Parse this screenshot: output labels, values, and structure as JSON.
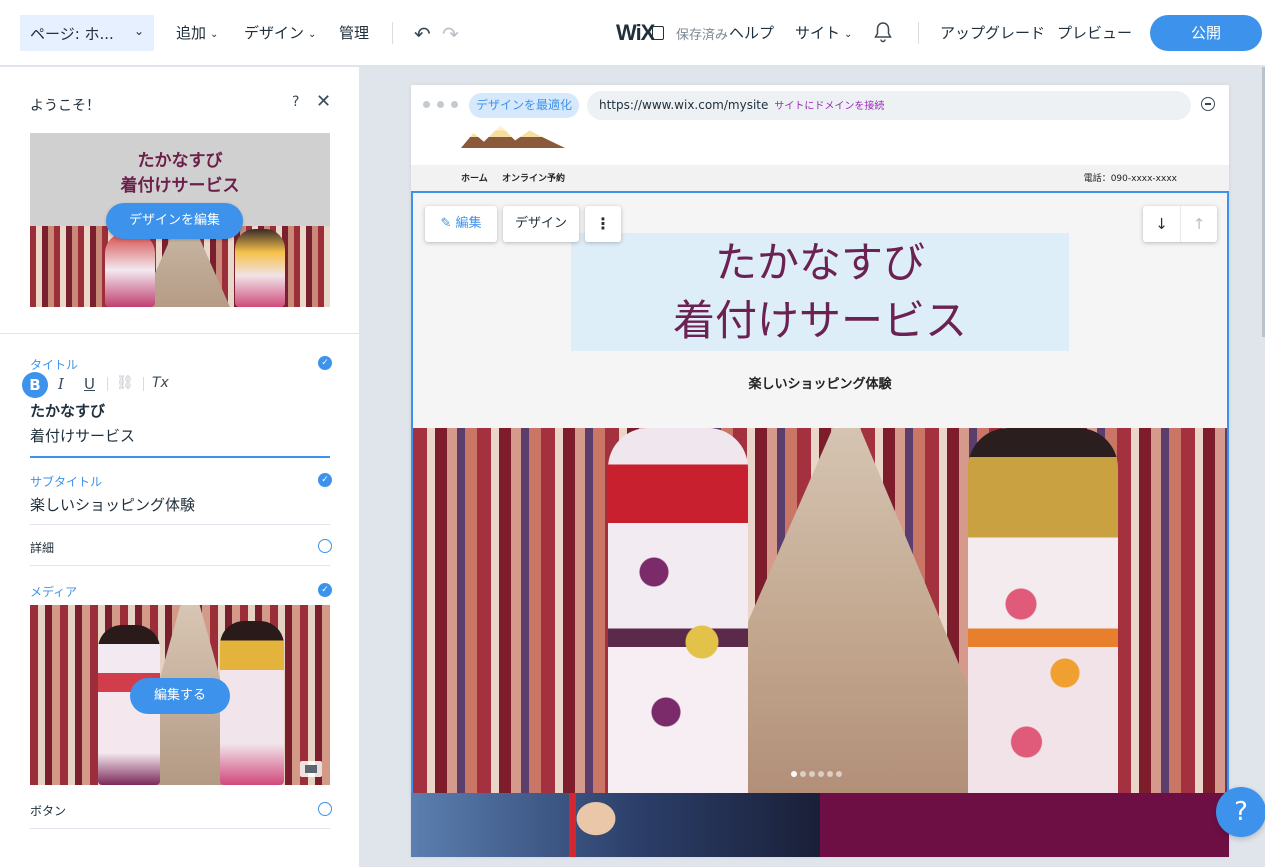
{
  "topbar": {
    "page_selector": "ページ: ホ...",
    "menus": [
      {
        "label": "追加"
      },
      {
        "label": "デザイン"
      },
      {
        "label": "管理"
      }
    ],
    "logo": "WiX",
    "saved_status": "保存済み",
    "help": "ヘルプ",
    "site": "サイト",
    "upgrade": "アップグレード",
    "preview": "プレビュー",
    "publish": "公開"
  },
  "panel": {
    "welcome": "ようこそ！",
    "help_mark": "?",
    "close_mark": "✕",
    "thumbnail": {
      "title_line1": "たかなすび",
      "title_line2": "着付けサービス",
      "edit_design_button": "デザインを編集"
    },
    "fields": {
      "title_label": "タイトル",
      "title_line1": "たかなすび",
      "title_line2": "着付けサービス",
      "subtitle_label": "サブタイトル",
      "subtitle_value": "楽しいショッピング体験",
      "details_label": "詳細",
      "media_label": "メディア",
      "media_edit_button": "編集する",
      "button_label": "ボタン"
    },
    "format_toolbar": {
      "bold": "B",
      "italic": "I",
      "underline": "U",
      "link": "⛓",
      "clear": "Tx"
    }
  },
  "canvas": {
    "optimize_button": "デザインを最適化",
    "url": "https://www.wix.com/mysite",
    "connect_domain": "サイトにドメインを接続",
    "site_nav": {
      "home": "ホーム",
      "booking": "オンライン予約",
      "phone": "電話：090-xxxx-xxxx"
    },
    "hero": {
      "title_line1": "たかなすび",
      "title_line2": "着付けサービス",
      "subtitle": "楽しいショッピング体験",
      "slide_count": 6,
      "active_slide": 1
    },
    "toolbar": {
      "edit": "編集",
      "design": "デザイン",
      "more": "⋮",
      "down": "↓",
      "up": "↑"
    }
  },
  "help_fab": "?",
  "colors": {
    "accent": "#3d93eb",
    "title_purple": "#6b2152",
    "section_magenta": "#6d0f45"
  }
}
